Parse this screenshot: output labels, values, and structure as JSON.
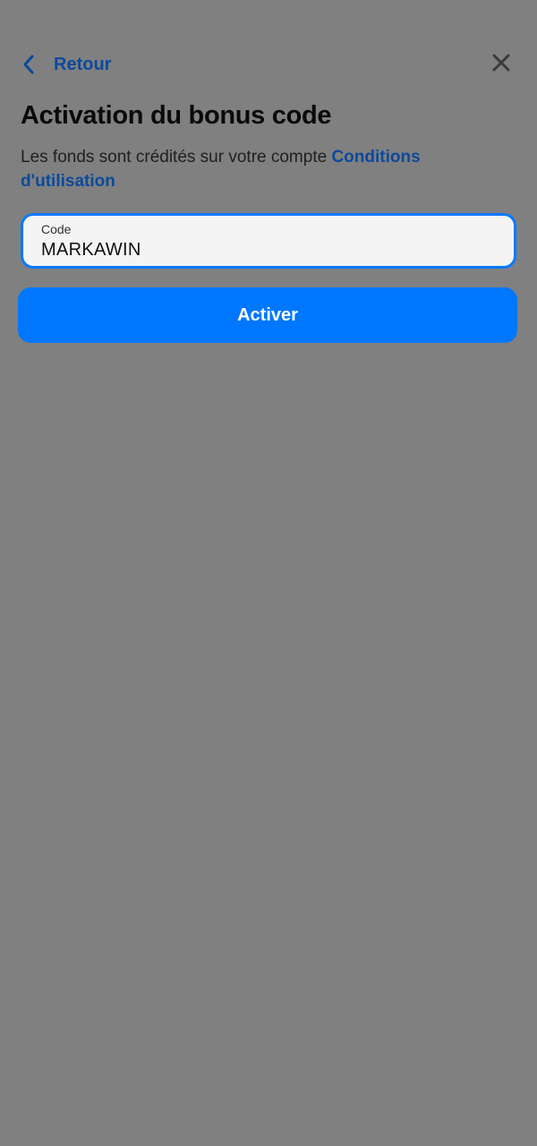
{
  "header": {
    "back_label": "Retour",
    "back_icon": "chevron-left-icon",
    "close_icon": "close-icon"
  },
  "page": {
    "title": "Activation du bonus code",
    "subtitle_text": "Les fonds sont crédités sur votre compte ",
    "terms_link": "Conditions d'utilisation"
  },
  "code_field": {
    "label": "Code",
    "value": "MARKAWIN"
  },
  "actions": {
    "activate_label": "Activer"
  },
  "colors": {
    "background": "#808080",
    "accent": "#0077ff",
    "link": "#0b4a9c",
    "focus_border": "#0a7aff"
  }
}
